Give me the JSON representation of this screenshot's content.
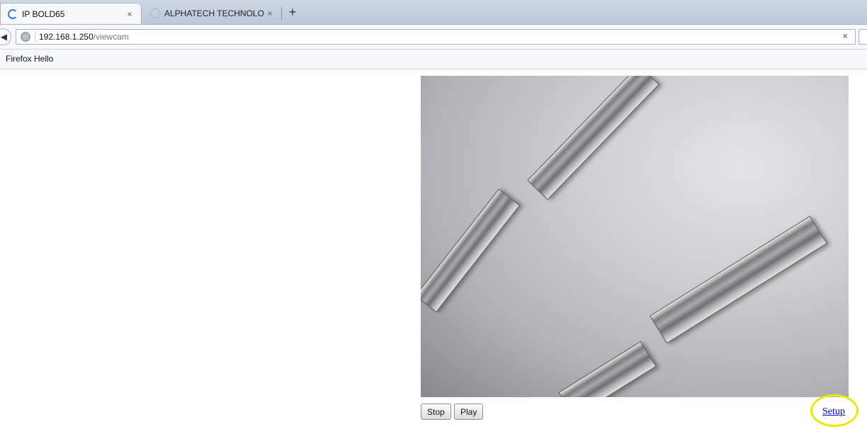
{
  "browser": {
    "tabs": [
      {
        "title": "IP BOLD65",
        "close_icon": "×",
        "active": true
      },
      {
        "title": "ALPHATECH TECHNOLOG...",
        "close_icon": "×",
        "active": false
      }
    ],
    "new_tab_icon": "+",
    "back_icon": "arrow-left-icon",
    "url": {
      "host": "192.168.1.250",
      "path": "/viewcam"
    },
    "url_clear_icon": "×",
    "bookmarks": [
      "Firefox Hello"
    ]
  },
  "page": {
    "buttons": {
      "stop": "Stop",
      "play": "Play"
    },
    "setup_link": "Setup",
    "highlight_color": "#f1e600"
  }
}
